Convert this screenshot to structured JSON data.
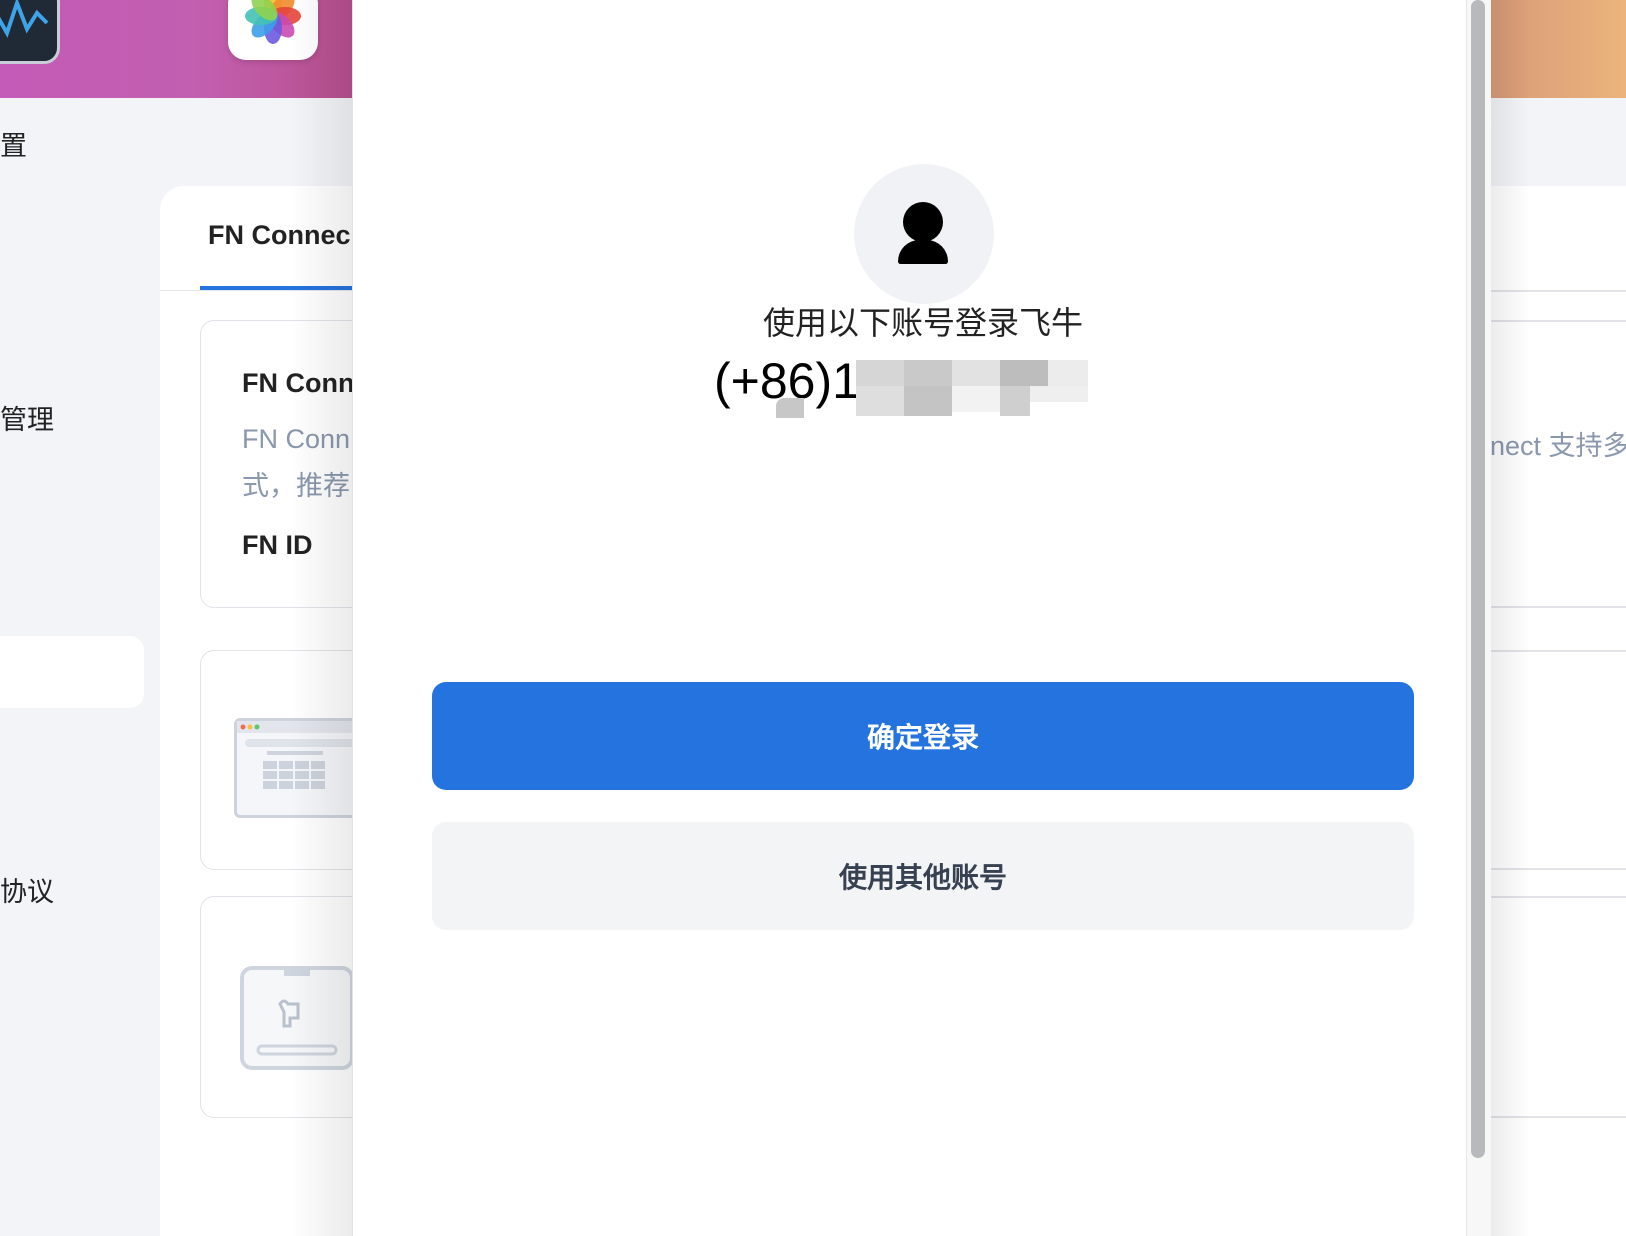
{
  "sidebar": {
    "items": [
      {
        "label": "置"
      },
      {
        "label": "管理"
      },
      {
        "label": "协议"
      }
    ]
  },
  "content": {
    "tab": "FN Connec",
    "card": {
      "title": "FN Conn",
      "desc_line1": "FN Conn",
      "desc_line2": "式，推荐",
      "id_label": "FN ID"
    },
    "right_partial_text": "nect 支持多"
  },
  "modal": {
    "login_caption": "使用以下账号登录飞牛",
    "account_visible": "(+86)1",
    "confirm_label": "确定登录",
    "other_account_label": "使用其他账号",
    "avatar_icon": "user-icon"
  },
  "colors": {
    "primary": "#2473de",
    "secondary_button_bg": "#f3f4f6",
    "muted_text": "#8a97ad"
  }
}
